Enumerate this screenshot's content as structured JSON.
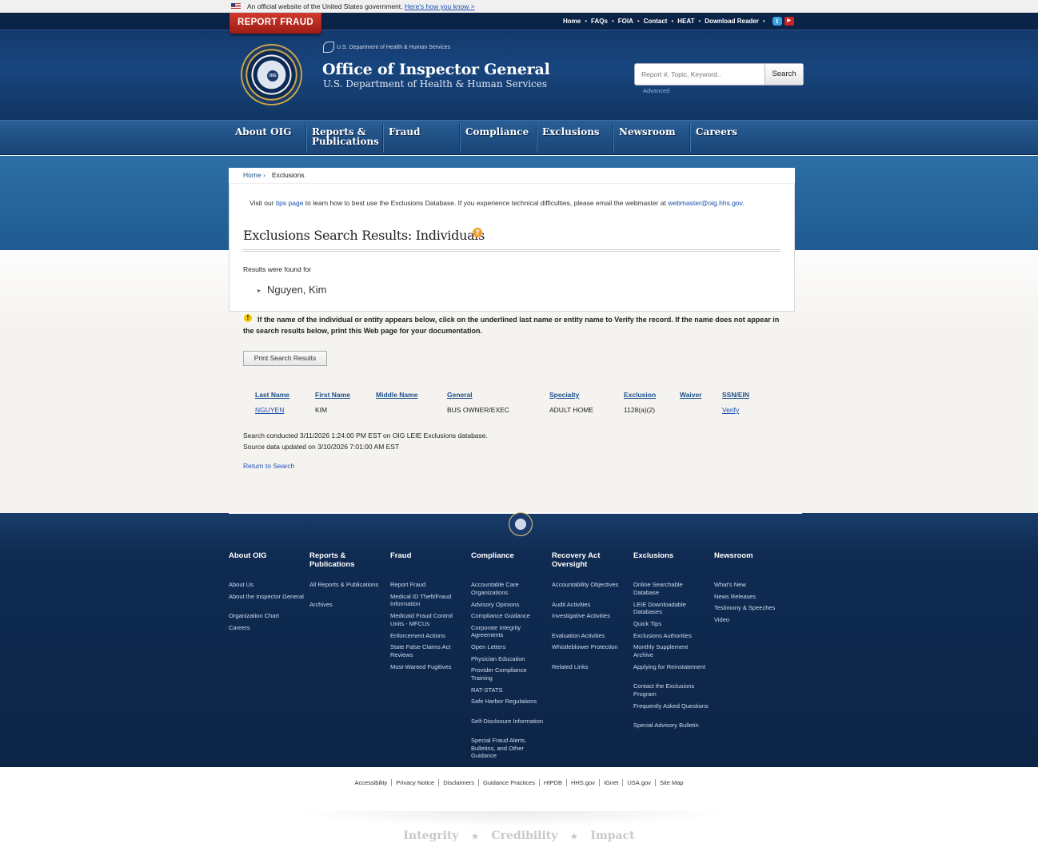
{
  "govbar": {
    "text": "An official website of the United States government.",
    "link": "Here's how you know >"
  },
  "header": {
    "report_fraud": "REPORT FRAUD",
    "util_nav": [
      "Home",
      "FAQs",
      "FOIA",
      "Contact",
      "HEAT",
      "Download Reader"
    ],
    "dept_small": "U.S. Department of Health & Human Services",
    "title": "Office of Inspector General",
    "subtitle": "U.S. Department of Health & Human Services",
    "search_placeholder": "Report #, Topic, Keyword..",
    "search_button": "Search",
    "advanced": "Advanced",
    "seal_text": "OIG"
  },
  "main_nav": [
    "About OIG",
    "Reports & Publications",
    "Fraud",
    "Compliance",
    "Exclusions",
    "Newsroom",
    "Careers"
  ],
  "breadcrumb": {
    "home": "Home",
    "current": "Exclusions"
  },
  "tips": {
    "pre": "Visit our ",
    "link": "tips page",
    "mid": " to learn how to best use the Exclusions Database. If you experience technical difficulties, please email the webmaster at ",
    "email": "webmaster@oig.hhs.gov",
    "post": "."
  },
  "page": {
    "heading": "Exclusions Search Results: Individuals",
    "found_label": "Results were found for",
    "search_name": "Nguyen, Kim",
    "warning": "If the name of the individual or entity appears below, click on the underlined last name or entity name to Verify the record. If the name does not appear in the search results below, print this Web page for your documentation.",
    "print_button": "Print Search Results",
    "meta1": "Search conducted 3/11/2026 1:24:00 PM EST on OIG LEIE Exclusions database.",
    "meta2": "Source data updated on 3/10/2026 7:01:00 AM EST",
    "return": "Return to Search"
  },
  "table": {
    "headers": [
      "Last Name",
      "First Name",
      "Middle Name",
      "General",
      "Specialty",
      "Exclusion",
      "Waiver",
      "SSN/EIN"
    ],
    "rows": [
      {
        "last": "NGUYEN",
        "first": "KIM",
        "middle": "",
        "general": "BUS OWNER/EXEC",
        "specialty": "ADULT HOME",
        "exclusion": "1128(a)(2)",
        "waiver": "",
        "ssn": "Verify"
      }
    ]
  },
  "footer": {
    "cols": [
      {
        "title": "About OIG",
        "links": [
          "About Us",
          "About the Inspector General",
          "Organization Chart",
          "Careers"
        ]
      },
      {
        "title": "Reports & Publications",
        "links": [
          "All Reports & Publications",
          "Archives"
        ]
      },
      {
        "title": "Fraud",
        "links": [
          "Report Fraud",
          "Medical ID Theft/Fraud Information",
          "Medicaid Fraud Control Units - MFCUs",
          "Enforcement Actions",
          "State False Claims Act Reviews",
          "Most-Wanted Fugitives"
        ]
      },
      {
        "title": "Compliance",
        "links": [
          "Accountable Care Organizations",
          "Advisory Opinions",
          "Compliance Guidance",
          "Corporate Integrity Agreements",
          "Open Letters",
          "Physician Education",
          "Provider Compliance Training",
          "RAT-STATS",
          "Safe Harbor Regulations",
          "Self-Disclosure Information",
          "Special Fraud Alerts, Bulletins, and Other Guidance"
        ]
      },
      {
        "title": "Recovery Act Oversight",
        "links": [
          "Accountability Objectives",
          "Audit Activities",
          "Investigative Activities",
          "Evaluation Activities",
          "Whistleblower Protection",
          "Related Links"
        ]
      },
      {
        "title": "Exclusions",
        "links": [
          "Online Searchable Database",
          "LEIE Downloadable Databases",
          "Quick Tips",
          "Exclusions Authorities",
          "Monthly Supplement Archive",
          "Applying for Reinstatement",
          "Contact the Exclusions Program",
          "Frequently Asked Questions",
          "Special Advisory Bulletin"
        ]
      },
      {
        "title": "Newsroom",
        "links": [
          "What's New",
          "News Releases",
          "Testimony & Speeches",
          "Video"
        ]
      }
    ]
  },
  "bottom_links": [
    "Accessibility",
    "Privacy Notice",
    "Disclaimers",
    "Guidance Practices",
    "HIPDB",
    "HHS.gov",
    "IGnet",
    "USA.gov",
    "Site Map"
  ],
  "motto": [
    "Integrity",
    "Credibility",
    "Impact"
  ]
}
